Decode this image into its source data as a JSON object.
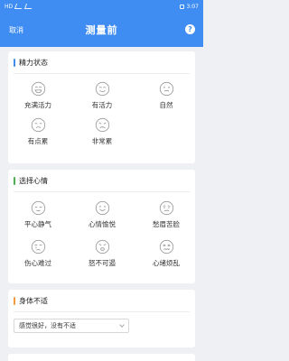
{
  "status_bar": {
    "carrier": "HD",
    "time": "3:07"
  },
  "header": {
    "cancel_label": "取消",
    "title": "测量前",
    "help_label": "?"
  },
  "energy": {
    "title": "精力状态",
    "options": [
      {
        "label": "充满活力",
        "icon": "grin-face-icon"
      },
      {
        "label": "有活力",
        "icon": "smile-face-icon"
      },
      {
        "label": "自然",
        "icon": "neutral-face-icon"
      },
      {
        "label": "有点累",
        "icon": "tired-face-icon"
      },
      {
        "label": "非常累",
        "icon": "very-tired-face-icon"
      }
    ]
  },
  "mood": {
    "title": "选择心情",
    "options": [
      {
        "label": "平心静气",
        "icon": "calm-face-icon"
      },
      {
        "label": "心情愉悦",
        "icon": "happy-face-icon"
      },
      {
        "label": "愁眉苦脸",
        "icon": "sad-face-icon"
      },
      {
        "label": "伤心难过",
        "icon": "crying-face-icon"
      },
      {
        "label": "怒不可遏",
        "icon": "angry-face-icon"
      },
      {
        "label": "心绪烦乱",
        "icon": "upset-face-icon"
      }
    ]
  },
  "discomfort": {
    "title": "身体不适",
    "selected": "感觉很好，没有不适"
  },
  "colors": {
    "primary": "#3f8df2",
    "background": "#eef0f4",
    "icon_stroke": "#9a9a9a"
  }
}
